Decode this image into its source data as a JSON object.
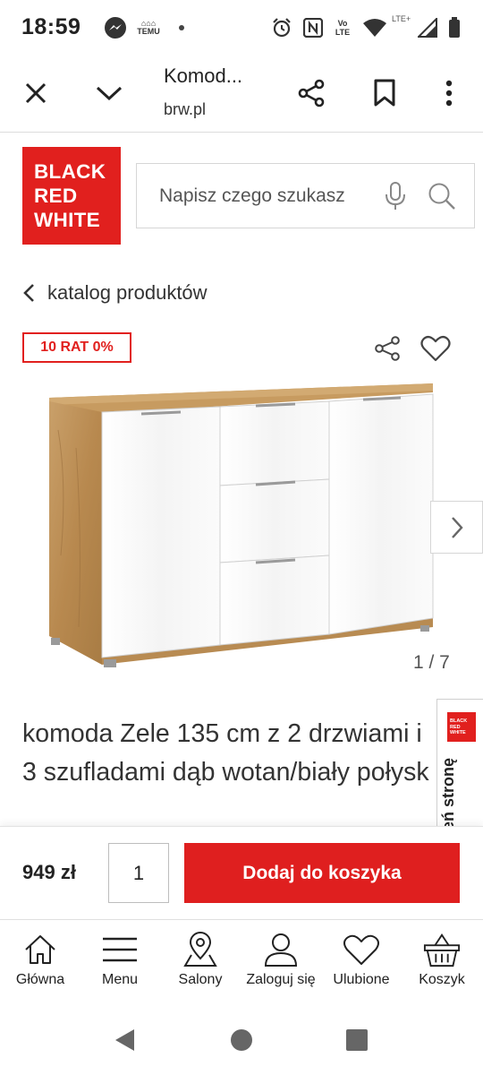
{
  "status_bar": {
    "time": "18:59",
    "temu_label": "TEMU",
    "network_label": "LTE+",
    "volte_line1": "Vo",
    "volte_line2": "LTE"
  },
  "browser": {
    "title": "Komod...",
    "url": "brw.pl"
  },
  "header": {
    "logo_lines": [
      "BLACK",
      "RED",
      "WHITE"
    ],
    "search_placeholder": "Napisz czego szukasz"
  },
  "breadcrumb": {
    "label": "katalog produktów"
  },
  "product": {
    "badge": "10 RAT 0%",
    "image_counter": "1 / 7",
    "title": "komoda Zele 135 cm z 2 drzwiami i 3 szufladami dąb wotan/biały połysk",
    "price": "949 zł",
    "quantity": "1",
    "add_to_cart_label": "Dodaj do koszyka"
  },
  "rate_tab": {
    "logo_lines": [
      "BLACK",
      "RED",
      "WHITE"
    ],
    "label": "Oceń stronę"
  },
  "bottom_nav": {
    "items": [
      {
        "label": "Główna",
        "icon": "home-icon"
      },
      {
        "label": "Menu",
        "icon": "menu-icon"
      },
      {
        "label": "Salony",
        "icon": "map-pin-icon"
      },
      {
        "label": "Zaloguj się",
        "icon": "user-icon"
      },
      {
        "label": "Ulubione",
        "icon": "heart-icon"
      },
      {
        "label": "Koszyk",
        "icon": "basket-icon"
      }
    ]
  },
  "colors": {
    "brand_red": "#e1201e",
    "button_red": "#df1f1f",
    "text_dark": "#222222"
  }
}
